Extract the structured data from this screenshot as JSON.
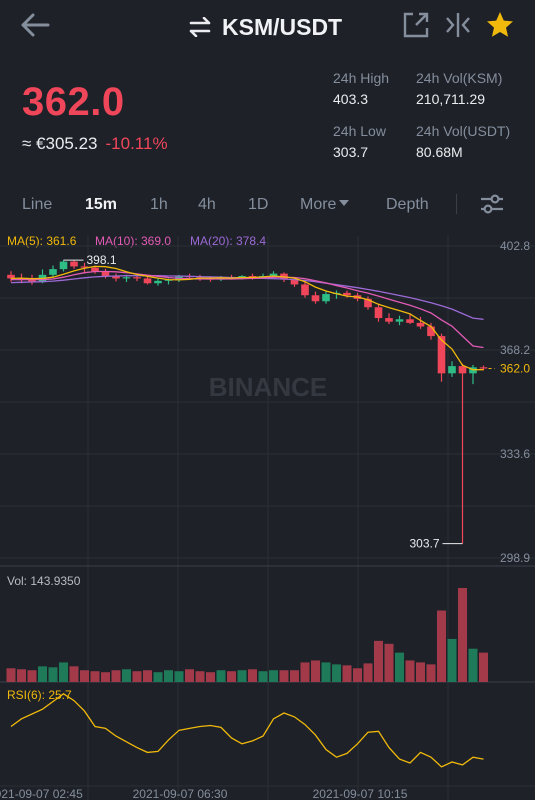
{
  "header": {
    "pair": "KSM/USDT",
    "icons": [
      "back-arrow-icon",
      "swap-icon",
      "share-icon",
      "compare-icon",
      "star-icon"
    ]
  },
  "ticker": {
    "last_price": "362.0",
    "fiat_price": "≈ €305.23",
    "change_pct": "-10.11%"
  },
  "stats": {
    "high_label": "24h High",
    "high": "403.3",
    "vol_base_label": "24h Vol(KSM)",
    "vol_base": "210,711.29",
    "low_label": "24h Low",
    "low": "303.7",
    "vol_quote_label": "24h Vol(USDT)",
    "vol_quote": "80.68M"
  },
  "tabs": [
    "Line",
    "15m",
    "1h",
    "4h",
    "1D",
    "More",
    "Depth"
  ],
  "active_tab": "15m",
  "indicators": {
    "ma5": "MA(5): 361.6",
    "ma10": "MA(10): 369.0",
    "ma20": "MA(20): 378.4",
    "vol": "Vol: 143.9350",
    "rsi": "RSI(6): 25.7"
  },
  "watermark": "BINANCE",
  "colors": {
    "up": "#2ebd85",
    "down": "#f0465a",
    "ma5": "#f0b90b",
    "ma10": "#e25bb5",
    "ma20": "#9c6ad6",
    "accent": "#f0b90b"
  },
  "chart_data": {
    "type": "candlestick",
    "price_axis": [
      "402.8",
      "368.2",
      "362.0",
      "333.6",
      "298.9"
    ],
    "ylim": [
      298.9,
      402.8
    ],
    "time_axis": [
      "2021-09-07 02:45",
      "2021-09-07 06:30",
      "2021-09-07 10:15"
    ],
    "high_marker": "398.1",
    "low_marker": "303.7",
    "last_marker": "362.0",
    "candles": [
      {
        "o": 393.2,
        "h": 394.4,
        "l": 390.9,
        "c": 392.0
      },
      {
        "o": 392.0,
        "h": 393.6,
        "l": 390.4,
        "c": 391.6
      },
      {
        "o": 391.6,
        "h": 393.2,
        "l": 389.9,
        "c": 390.8
      },
      {
        "o": 390.8,
        "h": 395.0,
        "l": 390.4,
        "c": 393.2
      },
      {
        "o": 393.2,
        "h": 396.3,
        "l": 392.4,
        "c": 395.1
      },
      {
        "o": 395.1,
        "h": 398.1,
        "l": 394.3,
        "c": 397.6
      },
      {
        "o": 397.6,
        "h": 398.1,
        "l": 395.2,
        "c": 396.0
      },
      {
        "o": 396.0,
        "h": 397.2,
        "l": 393.6,
        "c": 395.6
      },
      {
        "o": 395.6,
        "h": 396.3,
        "l": 393.6,
        "c": 394.4
      },
      {
        "o": 394.4,
        "h": 395.2,
        "l": 392.0,
        "c": 392.8
      },
      {
        "o": 392.8,
        "h": 393.6,
        "l": 391.0,
        "c": 392.0
      },
      {
        "o": 392.0,
        "h": 393.2,
        "l": 390.8,
        "c": 392.4
      },
      {
        "o": 392.4,
        "h": 393.2,
        "l": 391.1,
        "c": 392.0
      },
      {
        "o": 392.0,
        "h": 392.8,
        "l": 390.0,
        "c": 390.4
      },
      {
        "o": 390.4,
        "h": 392.0,
        "l": 389.6,
        "c": 391.2
      },
      {
        "o": 391.2,
        "h": 392.0,
        "l": 390.0,
        "c": 391.6
      },
      {
        "o": 391.6,
        "h": 393.2,
        "l": 390.8,
        "c": 392.8
      },
      {
        "o": 392.8,
        "h": 393.6,
        "l": 391.6,
        "c": 392.4
      },
      {
        "o": 392.4,
        "h": 393.2,
        "l": 391.2,
        "c": 392.0
      },
      {
        "o": 392.0,
        "h": 392.8,
        "l": 390.9,
        "c": 391.6
      },
      {
        "o": 391.6,
        "h": 392.8,
        "l": 391.1,
        "c": 392.2
      },
      {
        "o": 392.2,
        "h": 393.2,
        "l": 391.6,
        "c": 392.0
      },
      {
        "o": 392.0,
        "h": 393.1,
        "l": 391.6,
        "c": 392.8
      },
      {
        "o": 392.8,
        "h": 393.6,
        "l": 391.6,
        "c": 392.4
      },
      {
        "o": 392.4,
        "h": 393.6,
        "l": 392.0,
        "c": 392.8
      },
      {
        "o": 392.8,
        "h": 394.4,
        "l": 392.0,
        "c": 393.6
      },
      {
        "o": 393.6,
        "h": 394.0,
        "l": 390.8,
        "c": 391.6
      },
      {
        "o": 391.6,
        "h": 392.0,
        "l": 389.2,
        "c": 390.0
      },
      {
        "o": 390.0,
        "h": 391.2,
        "l": 385.6,
        "c": 386.4
      },
      {
        "o": 386.4,
        "h": 387.6,
        "l": 383.6,
        "c": 384.4
      },
      {
        "o": 384.4,
        "h": 387.6,
        "l": 383.6,
        "c": 386.8
      },
      {
        "o": 386.8,
        "h": 388.0,
        "l": 385.2,
        "c": 387.2
      },
      {
        "o": 387.2,
        "h": 388.0,
        "l": 385.6,
        "c": 386.4
      },
      {
        "o": 386.4,
        "h": 387.2,
        "l": 384.4,
        "c": 385.2
      },
      {
        "o": 385.2,
        "h": 386.0,
        "l": 381.6,
        "c": 382.4
      },
      {
        "o": 382.4,
        "h": 383.6,
        "l": 377.6,
        "c": 378.8
      },
      {
        "o": 378.8,
        "h": 380.4,
        "l": 376.8,
        "c": 377.6
      },
      {
        "o": 377.6,
        "h": 379.6,
        "l": 376.4,
        "c": 378.4
      },
      {
        "o": 378.4,
        "h": 380.0,
        "l": 376.8,
        "c": 377.2
      },
      {
        "o": 377.2,
        "h": 379.2,
        "l": 375.2,
        "c": 376.0
      },
      {
        "o": 376.0,
        "h": 377.2,
        "l": 371.6,
        "c": 372.8
      },
      {
        "o": 372.8,
        "h": 373.6,
        "l": 357.6,
        "c": 360.4
      },
      {
        "o": 360.4,
        "h": 364.4,
        "l": 359.2,
        "c": 362.8
      },
      {
        "o": 362.8,
        "h": 363.6,
        "l": 303.7,
        "c": 360.4
      },
      {
        "o": 360.4,
        "h": 363.2,
        "l": 356.8,
        "c": 362.4
      },
      {
        "o": 362.4,
        "h": 363.0,
        "l": 361.4,
        "c": 362.0
      }
    ],
    "ma5": [
      392.0,
      392.1,
      391.9,
      392.0,
      392.4,
      393.4,
      394.5,
      395.4,
      396.0,
      395.9,
      395.3,
      394.2,
      393.3,
      392.7,
      392.1,
      391.6,
      391.5,
      391.7,
      392.1,
      392.1,
      392.2,
      392.1,
      392.3,
      392.3,
      392.5,
      392.8,
      392.5,
      392.1,
      390.9,
      389.1,
      387.8,
      386.9,
      386.1,
      385.8,
      384.9,
      383.4,
      382.3,
      381.3,
      380.2,
      378.0,
      376.0,
      371.5,
      368.5,
      363.1,
      361.6,
      361.6
    ],
    "ma10": [
      391.6,
      391.6,
      391.6,
      391.6,
      391.8,
      392.4,
      393.2,
      393.9,
      394.3,
      394.3,
      394.2,
      393.9,
      393.5,
      393.1,
      392.7,
      392.3,
      392.0,
      391.9,
      391.8,
      391.8,
      391.8,
      391.8,
      391.9,
      392.0,
      392.2,
      392.4,
      392.4,
      392.3,
      391.9,
      391.2,
      390.5,
      389.6,
      388.8,
      387.9,
      387.1,
      386.1,
      385.1,
      384.1,
      383.1,
      381.9,
      380.5,
      378.2,
      376.1,
      372.8,
      369.5,
      369.0
    ],
    "ma20": [
      390.6,
      390.7,
      390.8,
      390.9,
      391.1,
      391.4,
      391.8,
      392.2,
      392.5,
      392.7,
      392.8,
      392.9,
      392.9,
      392.9,
      392.9,
      392.8,
      392.8,
      392.7,
      392.6,
      392.5,
      392.4,
      392.3,
      392.2,
      392.1,
      392.0,
      391.9,
      391.8,
      391.6,
      391.3,
      390.9,
      390.4,
      389.9,
      389.4,
      388.9,
      388.3,
      387.7,
      387.0,
      386.3,
      385.6,
      384.8,
      383.9,
      382.9,
      381.8,
      380.3,
      378.8,
      378.4
    ],
    "volumes": [
      14,
      13,
      12,
      16,
      15,
      20,
      16,
      12,
      11,
      10,
      12,
      13,
      11,
      12,
      10,
      12,
      11,
      13,
      11,
      10,
      12,
      11,
      12,
      13,
      11,
      12,
      12,
      12,
      20,
      22,
      20,
      18,
      17,
      14,
      19,
      42,
      39,
      30,
      22,
      20,
      18,
      73,
      44,
      96,
      34,
      30
    ],
    "rsi": [
      62,
      70,
      75,
      80,
      88,
      96,
      89,
      78,
      62,
      60,
      52,
      46,
      40,
      35,
      36,
      48,
      58,
      60,
      62,
      63,
      61,
      50,
      44,
      47,
      52,
      70,
      76,
      72,
      64,
      53,
      38,
      30,
      34,
      44,
      56,
      57,
      40,
      28,
      24,
      35,
      30,
      20,
      25,
      22,
      30,
      28
    ]
  }
}
